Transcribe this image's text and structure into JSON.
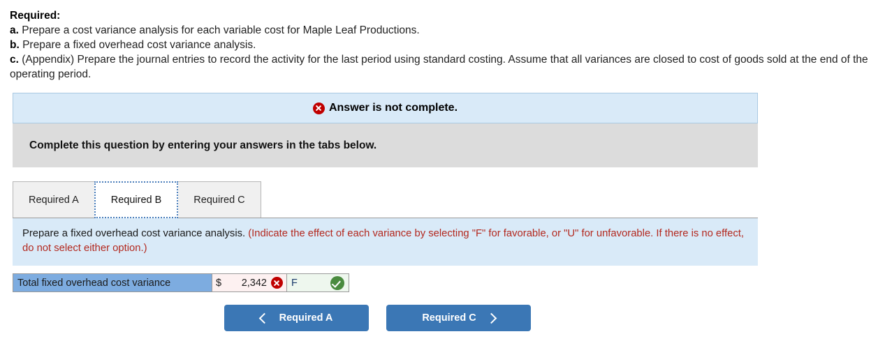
{
  "prompt": {
    "title": "Required:",
    "items": [
      {
        "marker": "a.",
        "text": " Prepare a cost variance analysis for each variable cost for Maple Leaf Productions."
      },
      {
        "marker": "b.",
        "text": " Prepare a fixed overhead cost variance analysis."
      },
      {
        "marker": "c.",
        "text": " (Appendix) Prepare the journal entries to record the activity for the last period using standard costing. Assume that all variances are closed to cost of goods sold at the end of the operating period."
      }
    ]
  },
  "alert": {
    "icon": "error-x-icon",
    "text": "Answer is not complete."
  },
  "gray_band": {
    "text": "Complete this question by entering your answers in the tabs below."
  },
  "tabs": [
    {
      "label": "Required A",
      "active": false
    },
    {
      "label": "Required B",
      "active": true
    },
    {
      "label": "Required C",
      "active": false
    }
  ],
  "instruction": {
    "black_part": "Prepare a fixed overhead cost variance analysis. ",
    "red_part": "(Indicate the effect of each variance by selecting \"F\" for favorable, or \"U\" for unfavorable. If there is no effect, do not select either option.)"
  },
  "answer_row": {
    "label": "Total fixed overhead cost variance",
    "currency": "$",
    "amount": "2,342",
    "amount_status_icon": "error-x-icon",
    "effect": "F",
    "effect_status_icon": "success-check-icon"
  },
  "nav": {
    "prev_label": "Required A",
    "next_label": "Required C",
    "prev_icon": "chevron-left-icon",
    "next_icon": "chevron-right-icon"
  },
  "colors": {
    "panel_blue": "#d9eaf8",
    "band_gray": "#dcdcdc",
    "label_blue": "#7dace0",
    "button_blue": "#3b77b5",
    "error_red": "#c00000",
    "success_green": "#4a8b3f",
    "instruction_red": "#b3281e"
  }
}
